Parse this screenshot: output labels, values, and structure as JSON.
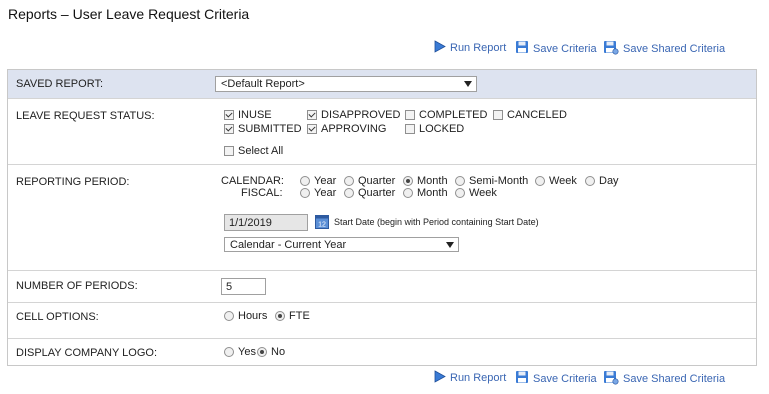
{
  "page_title": "Reports – User Leave Request Criteria",
  "toolbar": {
    "run_report": "Run Report",
    "save_criteria": "Save Criteria",
    "save_shared_criteria": "Save Shared Criteria"
  },
  "saved_report": {
    "label": "SAVED REPORT:",
    "value": "<Default Report>"
  },
  "leave_status": {
    "label": "LEAVE REQUEST STATUS:",
    "options": [
      {
        "label": "INUSE",
        "checked": true
      },
      {
        "label": "DISAPPROVED",
        "checked": true
      },
      {
        "label": "COMPLETED",
        "checked": false
      },
      {
        "label": "CANCELED",
        "checked": false
      },
      {
        "label": "SUBMITTED",
        "checked": true
      },
      {
        "label": "APPROVING",
        "checked": true
      },
      {
        "label": "LOCKED",
        "checked": false
      }
    ],
    "select_all": "Select All"
  },
  "reporting_period": {
    "label": "REPORTING PERIOD:",
    "calendar_label": "CALENDAR:",
    "fiscal_label": "FISCAL:",
    "calendar_options": [
      "Year",
      "Quarter",
      "Month",
      "Semi-Month",
      "Week",
      "Day"
    ],
    "calendar_selected": "Month",
    "fiscal_options": [
      "Year",
      "Quarter",
      "Month",
      "Week"
    ],
    "start_date": "1/1/2019",
    "start_date_note": "Start Date (begin with Period containing Start Date)",
    "range_value": "Calendar - Current Year"
  },
  "num_periods": {
    "label": "NUMBER OF PERIODS:",
    "value": "5"
  },
  "cell_options": {
    "label": "CELL OPTIONS:",
    "options": [
      "Hours",
      "FTE"
    ],
    "selected": "FTE"
  },
  "company_logo": {
    "label": "DISPLAY COMPANY LOGO:",
    "options": [
      "Yes",
      "No"
    ],
    "selected": "No"
  },
  "colors": {
    "link": "#3a66b3",
    "header_row": "#dde3f0",
    "border": "#d4d4d4"
  },
  "icons": {
    "run": "play-icon",
    "save": "floppy-icon",
    "save_shared": "shared-floppy-icon",
    "calendar": "calendar-icon"
  }
}
